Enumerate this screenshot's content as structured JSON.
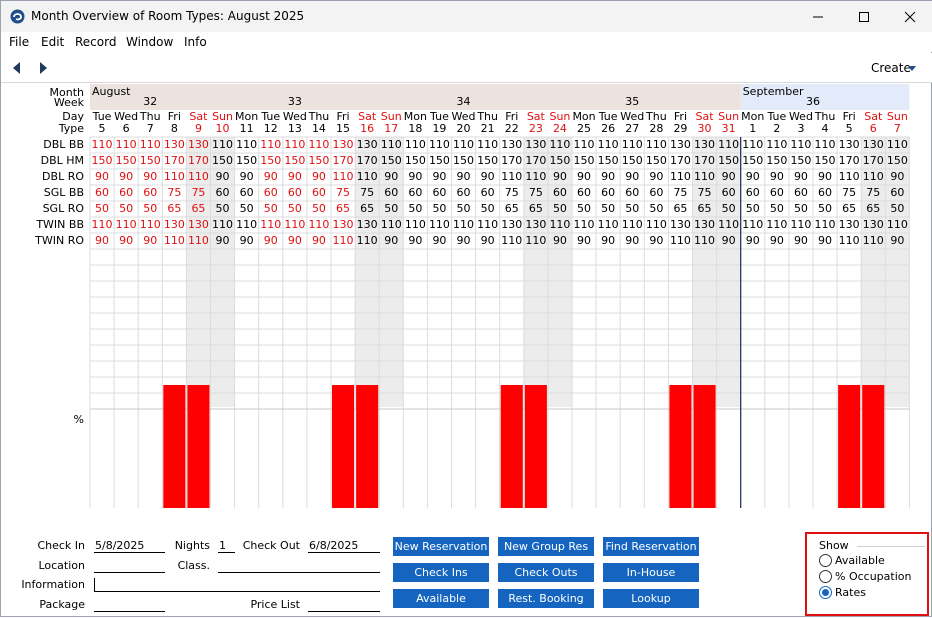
{
  "window": {
    "title": "Month Overview of Room Types: August 2025",
    "minimize_icon": "minimize-icon",
    "maximize_icon": "maximize-icon",
    "close_icon": "close-icon"
  },
  "menu": [
    "File",
    "Edit",
    "Record",
    "Window",
    "Info"
  ],
  "toolbar": {
    "create_label": "Create"
  },
  "grid": {
    "row_labels": {
      "month": "Month",
      "week": "Week",
      "day": "Day",
      "type": "Type",
      "percent": "%"
    },
    "months": [
      {
        "name": "August",
        "start": 0,
        "end": 27
      },
      {
        "name": "September",
        "start": 27,
        "end": 34
      }
    ],
    "weeks": [
      {
        "num": "32",
        "start": 0,
        "end": 5
      },
      {
        "num": "33",
        "start": 5,
        "end": 12
      },
      {
        "num": "34",
        "start": 12,
        "end": 19
      },
      {
        "num": "35",
        "start": 19,
        "end": 26
      },
      {
        "num": "36",
        "start": 26,
        "end": 34
      }
    ],
    "days": [
      [
        "Tue",
        "5"
      ],
      [
        "Wed",
        "6"
      ],
      [
        "Thu",
        "7"
      ],
      [
        "Fri",
        "8"
      ],
      [
        "Sat",
        "9"
      ],
      [
        "Sun",
        "10"
      ],
      [
        "Mon",
        "11"
      ],
      [
        "Tue",
        "12"
      ],
      [
        "Wed",
        "13"
      ],
      [
        "Thu",
        "14"
      ],
      [
        "Fri",
        "15"
      ],
      [
        "Sat",
        "16"
      ],
      [
        "Sun",
        "17"
      ],
      [
        "Mon",
        "18"
      ],
      [
        "Tue",
        "19"
      ],
      [
        "Wed",
        "20"
      ],
      [
        "Thu",
        "21"
      ],
      [
        "Fri",
        "22"
      ],
      [
        "Sat",
        "23"
      ],
      [
        "Sun",
        "24"
      ],
      [
        "Mon",
        "25"
      ],
      [
        "Tue",
        "26"
      ],
      [
        "Wed",
        "27"
      ],
      [
        "Thu",
        "28"
      ],
      [
        "Fri",
        "29"
      ],
      [
        "Sat",
        "30"
      ],
      [
        "Sun",
        "31"
      ],
      [
        "Mon",
        "1"
      ],
      [
        "Tue",
        "2"
      ],
      [
        "Wed",
        "3"
      ],
      [
        "Thu",
        "4"
      ],
      [
        "Fri",
        "5"
      ],
      [
        "Sat",
        "6"
      ],
      [
        "Sun",
        "7"
      ]
    ],
    "room_types": [
      "DBL BB",
      "DBL HM",
      "DBL RO",
      "SGL BB",
      "SGL RO",
      "TWIN BB",
      "TWIN RO"
    ],
    "rates": [
      [
        "110",
        "110",
        "110",
        "130",
        "130",
        "110",
        "110",
        "110",
        "110",
        "110",
        "130",
        "130",
        "110",
        "110",
        "110",
        "110",
        "110",
        "130",
        "130",
        "110",
        "110",
        "110",
        "110",
        "110",
        "130",
        "130",
        "110",
        "110",
        "110",
        "110",
        "110",
        "130",
        "130",
        "110"
      ],
      [
        "150",
        "150",
        "150",
        "170",
        "170",
        "150",
        "150",
        "150",
        "150",
        "150",
        "170",
        "170",
        "150",
        "150",
        "150",
        "150",
        "150",
        "170",
        "170",
        "150",
        "150",
        "150",
        "150",
        "150",
        "170",
        "170",
        "150",
        "150",
        "150",
        "150",
        "150",
        "170",
        "170",
        "150"
      ],
      [
        "90",
        "90",
        "90",
        "110",
        "110",
        "90",
        "90",
        "90",
        "90",
        "90",
        "110",
        "110",
        "90",
        "90",
        "90",
        "90",
        "90",
        "110",
        "110",
        "90",
        "90",
        "90",
        "90",
        "90",
        "110",
        "110",
        "90",
        "90",
        "90",
        "90",
        "90",
        "110",
        "110",
        "90"
      ],
      [
        "60",
        "60",
        "60",
        "75",
        "75",
        "60",
        "60",
        "60",
        "60",
        "60",
        "75",
        "75",
        "60",
        "60",
        "60",
        "60",
        "60",
        "75",
        "75",
        "60",
        "60",
        "60",
        "60",
        "60",
        "75",
        "75",
        "60",
        "60",
        "60",
        "60",
        "60",
        "75",
        "75",
        "60"
      ],
      [
        "50",
        "50",
        "50",
        "65",
        "65",
        "50",
        "50",
        "50",
        "50",
        "50",
        "65",
        "65",
        "50",
        "50",
        "50",
        "50",
        "50",
        "65",
        "65",
        "50",
        "50",
        "50",
        "50",
        "50",
        "65",
        "65",
        "50",
        "50",
        "50",
        "50",
        "50",
        "65",
        "65",
        "50"
      ],
      [
        "110",
        "110",
        "110",
        "130",
        "130",
        "110",
        "110",
        "110",
        "110",
        "110",
        "130",
        "130",
        "110",
        "110",
        "110",
        "110",
        "110",
        "130",
        "130",
        "110",
        "110",
        "110",
        "110",
        "110",
        "130",
        "130",
        "110",
        "110",
        "110",
        "110",
        "110",
        "130",
        "130",
        "110"
      ],
      [
        "90",
        "90",
        "90",
        "110",
        "110",
        "90",
        "90",
        "90",
        "90",
        "90",
        "110",
        "110",
        "90",
        "90",
        "90",
        "90",
        "90",
        "110",
        "110",
        "90",
        "90",
        "90",
        "90",
        "90",
        "110",
        "110",
        "90",
        "90",
        "90",
        "90",
        "90",
        "110",
        "110",
        "90"
      ]
    ],
    "red_rate_days": [
      0,
      1,
      2,
      3,
      4,
      7,
      8,
      9,
      10
    ],
    "red_day_header_days": [
      4,
      5,
      11,
      12,
      18,
      19,
      25,
      26,
      32,
      33
    ],
    "occupancy_bar_days": [
      3,
      4,
      10,
      11,
      17,
      18,
      24,
      25,
      31,
      32
    ],
    "colors": {
      "month_bg": "#ede3de",
      "month_bg_next": "#e3eafa",
      "weekend_col": "#ececec",
      "bar": "#ff0000",
      "red_text": "#e01010",
      "divider": "#1a2a5a"
    }
  },
  "form": {
    "check_in_label": "Check In",
    "check_in": "5/8/2025",
    "nights_label": "Nights",
    "nights": "1",
    "check_out_label": "Check Out",
    "check_out": "6/8/2025",
    "location_label": "Location",
    "location": "",
    "class_label": "Class.",
    "class": "",
    "information_label": "Information",
    "information": "",
    "package_label": "Package",
    "package": "",
    "price_list_label": "Price List",
    "price_list": ""
  },
  "buttons": {
    "new_reservation": "New Reservation",
    "new_group_res": "New Group Res",
    "find_reservation": "Find Reservation",
    "check_ins": "Check Ins",
    "check_outs": "Check Outs",
    "in_house": "In-House",
    "available": "Available",
    "rest_booking": "Rest. Booking",
    "lookup": "Lookup"
  },
  "show": {
    "title": "Show",
    "options": [
      {
        "label": "Available",
        "selected": false
      },
      {
        "label": "% Occupation",
        "selected": false
      },
      {
        "label": "Rates",
        "selected": true
      }
    ]
  }
}
